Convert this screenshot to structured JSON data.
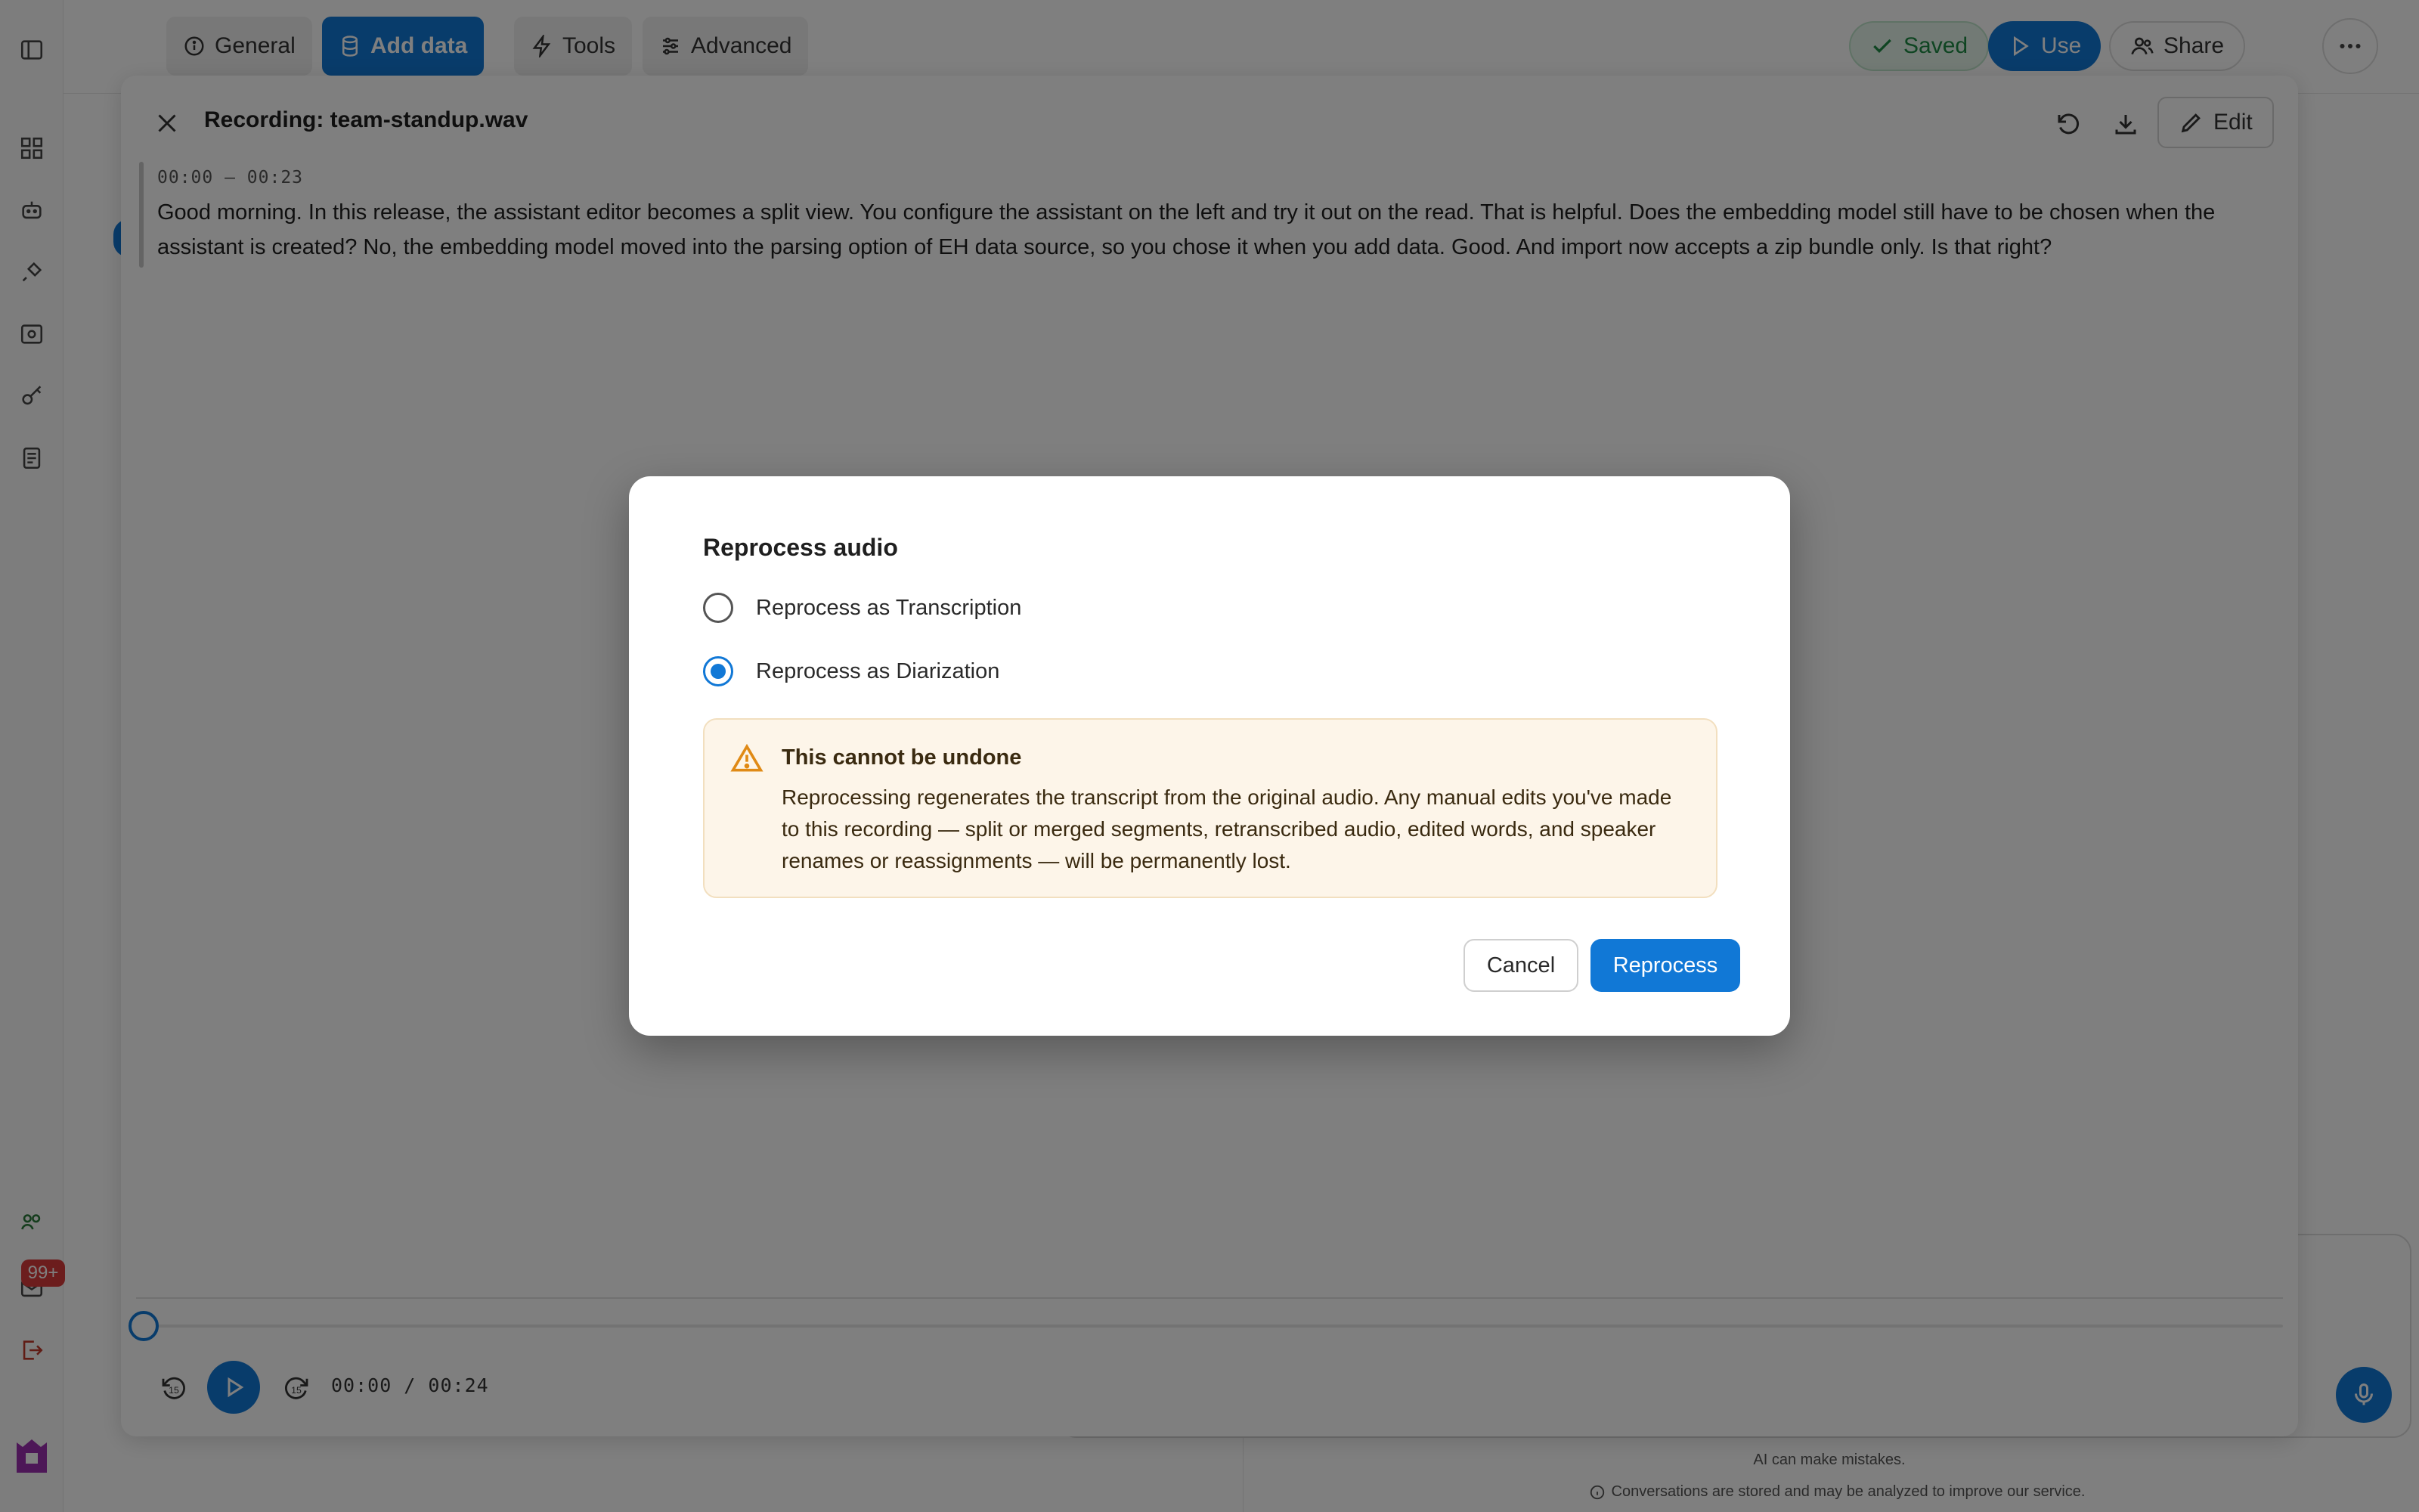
{
  "topbar": {
    "tabs": [
      {
        "label": "General",
        "icon": "info-icon"
      },
      {
        "label": "Add data",
        "icon": "database-icon"
      },
      {
        "label": "Tools",
        "icon": "bolt-icon"
      },
      {
        "label": "Advanced",
        "icon": "sliders-icon"
      }
    ],
    "active_tab": "Add data",
    "saved_label": "Saved",
    "use_label": "Use",
    "share_label": "Share"
  },
  "left_rail": {
    "notification_badge": "99+"
  },
  "recording": {
    "title": "Recording: team-standup.wav",
    "edit_label": "Edit",
    "segment": {
      "time_range": "00:00 – 00:23",
      "text": "Good morning. In this release, the assistant editor becomes a split view. You configure the assistant on the left and try it out on the read. That is helpful. Does the embedding model still have to be chosen when the assistant is created? No, the embedding model moved into the parsing option of EH data source, so you chose it when you add data. Good. And import now accepts a zip bundle only. Is that right?"
    },
    "player": {
      "time_readout": "00:00 / 00:24",
      "progress_fraction": 0
    }
  },
  "chat": {
    "disclaimer": "AI can make mistakes.",
    "privacy_note": "Conversations are stored and may be analyzed to improve our service."
  },
  "modal": {
    "title": "Reprocess audio",
    "options": [
      {
        "label": "Reprocess as Transcription",
        "selected": false
      },
      {
        "label": "Reprocess as Diarization",
        "selected": true
      }
    ],
    "warning": {
      "title": "This cannot be undone",
      "body": "Reprocessing regenerates the transcript from the original audio. Any manual edits you've made to this recording — split or merged segments, retranscribed audio, edited words, and speaker renames or reassignments — will be permanently lost."
    },
    "cancel_label": "Cancel",
    "confirm_label": "Reprocess"
  },
  "colors": {
    "accent": "#1178d6",
    "warning_bg": "#fdf5e9",
    "warning_icon": "#e08a16",
    "saved_green": "#1f8a45"
  }
}
